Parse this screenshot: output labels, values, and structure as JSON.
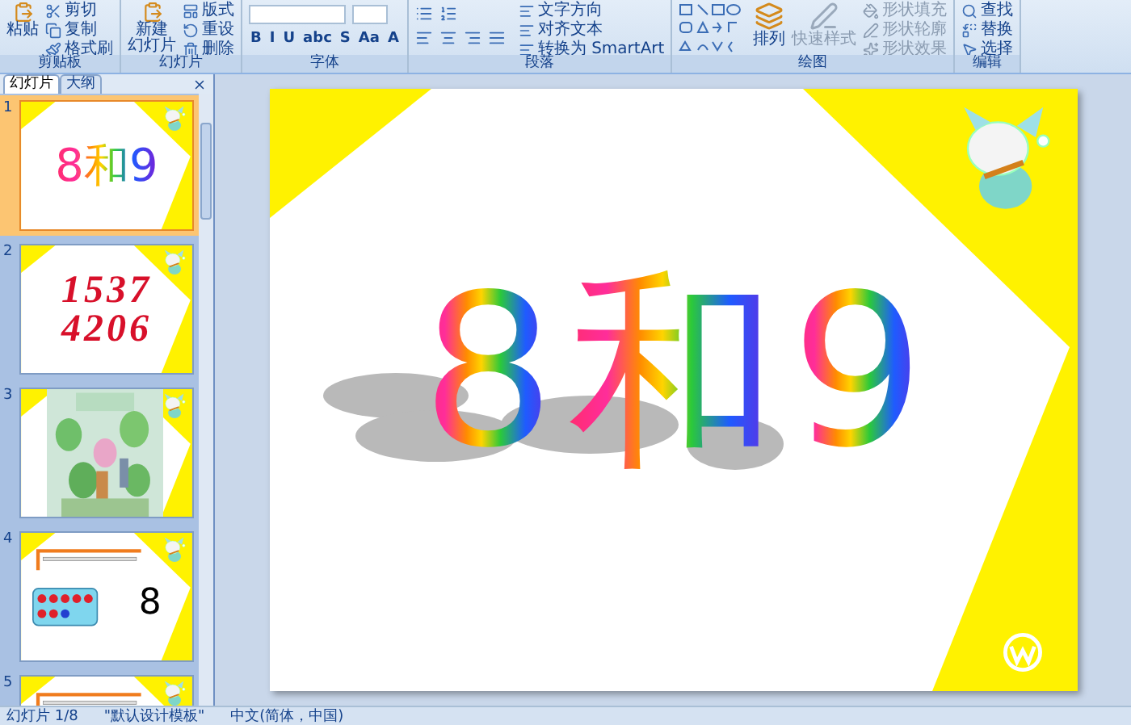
{
  "ribbon": {
    "groups": [
      {
        "label": "剪贴板",
        "large": [
          "粘贴"
        ],
        "small": [
          "剪切",
          "复制",
          "格式刷"
        ]
      },
      {
        "label": "幻灯片",
        "large": [
          "新建",
          "幻灯片"
        ],
        "small": [
          "版式",
          "重设",
          "删除"
        ]
      },
      {
        "label": "字体",
        "kind": "font",
        "format_buttons": [
          "B",
          "I",
          "U",
          "abc",
          "S",
          "Aa",
          "A"
        ]
      },
      {
        "label": "段落",
        "kind": "paragraph",
        "small": [
          "文字方向",
          "对齐文本",
          "转换为 SmartArt"
        ]
      },
      {
        "label": "绘图",
        "kind": "drawing",
        "large": "排列",
        "large_2": "快速样式",
        "small": [
          "形状填充",
          "形状轮廓",
          "形状效果"
        ]
      },
      {
        "label": "编辑",
        "kind": "editing",
        "small": [
          "查找",
          "替换",
          "选择"
        ]
      }
    ]
  },
  "pane_tabs": [
    {
      "label": "幻灯片",
      "selected": true
    },
    {
      "label": "大纲",
      "selected": false
    }
  ],
  "slides": [
    {
      "number": "1",
      "selected": true,
      "kind": "title",
      "texts": [
        "8",
        "和",
        "9"
      ]
    },
    {
      "number": "2",
      "selected": false,
      "kind": "digits",
      "texts": [
        "1537",
        "4206"
      ]
    },
    {
      "number": "3",
      "selected": false,
      "kind": "picture"
    },
    {
      "number": "4",
      "selected": false,
      "kind": "counting",
      "texts": [
        "8"
      ]
    },
    {
      "number": "5",
      "selected": false,
      "kind": "counting"
    }
  ],
  "slide": {
    "title": [
      "8",
      "和",
      "9"
    ]
  },
  "status_bar": [
    "幻灯片 1/8",
    "\"默认设计模板\"",
    "中文(简体，中国)"
  ]
}
